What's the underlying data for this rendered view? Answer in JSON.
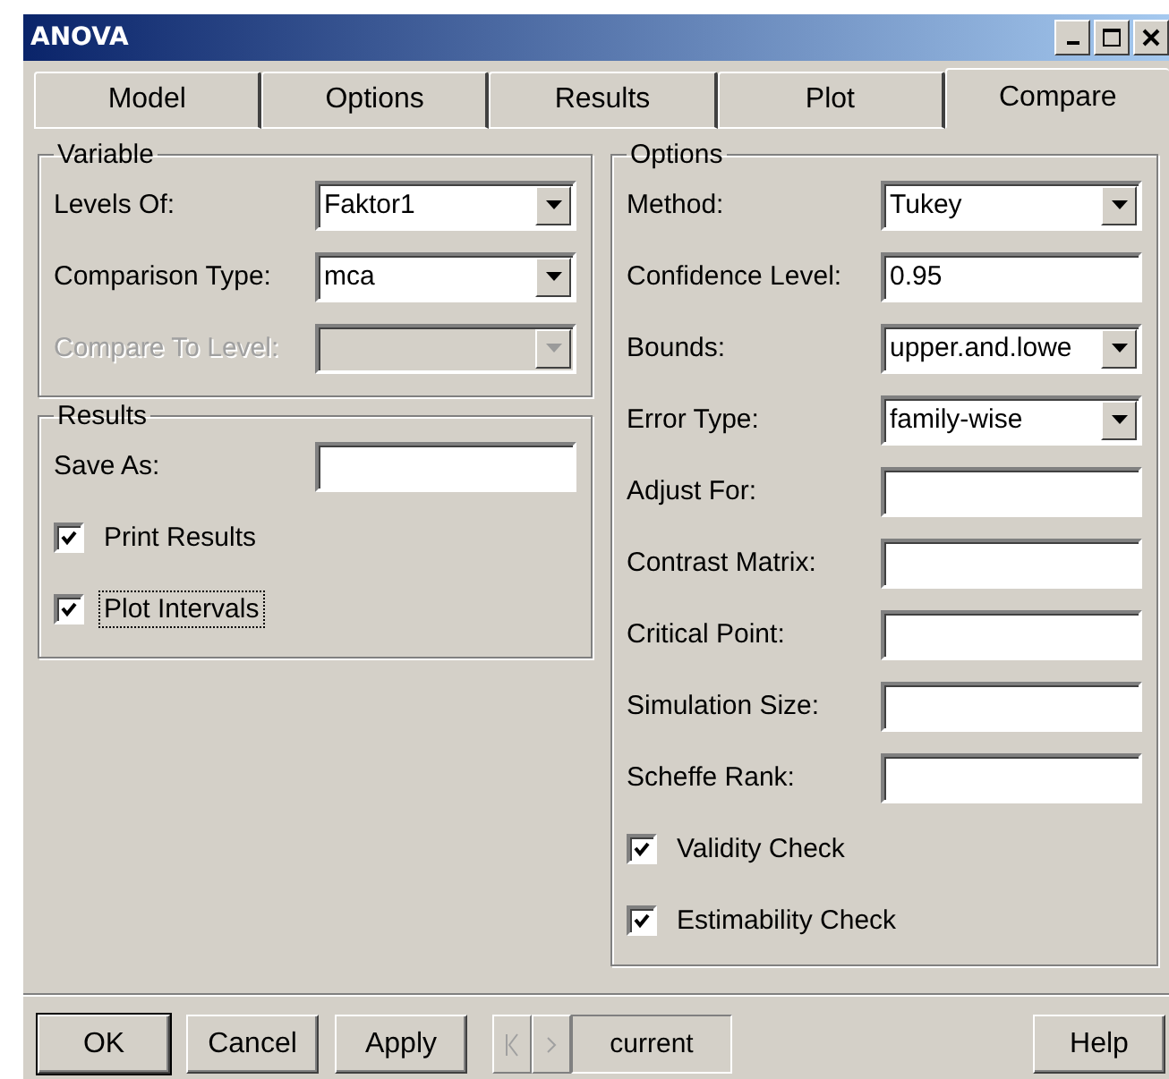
{
  "window": {
    "title": "ANOVA"
  },
  "tabs": [
    {
      "label": "Model",
      "selected": false
    },
    {
      "label": "Options",
      "selected": false
    },
    {
      "label": "Results",
      "selected": false
    },
    {
      "label": "Plot",
      "selected": false
    },
    {
      "label": "Compare",
      "selected": true
    }
  ],
  "variable_group": {
    "title": "Variable",
    "fields": [
      {
        "label": "Levels Of:",
        "kind": "dropdown",
        "value": "Faktor1",
        "disabled": false
      },
      {
        "label": "Comparison Type:",
        "kind": "dropdown",
        "value": "mca",
        "disabled": false
      },
      {
        "label": "Compare To Level:",
        "kind": "dropdown",
        "disabled": true
      }
    ]
  },
  "results_group": {
    "title": "Results",
    "fields": [
      {
        "label": "Save As:",
        "kind": "text"
      }
    ],
    "checkboxes": [
      {
        "label": "Print Results",
        "checked": true,
        "focused": false
      },
      {
        "label": "Plot Intervals",
        "checked": true,
        "focused": true
      }
    ]
  },
  "options_group": {
    "title": "Options",
    "fields": [
      {
        "label": "Method:",
        "kind": "dropdown",
        "value": "Tukey"
      },
      {
        "label": "Confidence Level:",
        "kind": "text",
        "value": "0.95"
      },
      {
        "label": "Bounds:",
        "kind": "dropdown",
        "value": "upper.and.lowe"
      },
      {
        "label": "Error Type:",
        "kind": "dropdown",
        "value": "family-wise"
      },
      {
        "label": "Adjust For:",
        "kind": "text"
      },
      {
        "label": "Contrast Matrix:",
        "kind": "text"
      },
      {
        "label": "Critical Point:",
        "kind": "text"
      },
      {
        "label": "Simulation Size:",
        "kind": "text"
      },
      {
        "label": "Scheffe Rank:",
        "kind": "text"
      }
    ],
    "checkboxes": [
      {
        "label": "Validity Check",
        "checked": true,
        "focused": false
      },
      {
        "label": "Estimability Check",
        "checked": true,
        "focused": false
      }
    ]
  },
  "buttons": [
    {
      "label": "OK",
      "default": true
    },
    {
      "label": "Cancel",
      "default": false
    },
    {
      "label": "Apply",
      "default": false
    }
  ],
  "navigator": {
    "label": "current"
  },
  "help_button": {
    "label": "Help"
  }
}
